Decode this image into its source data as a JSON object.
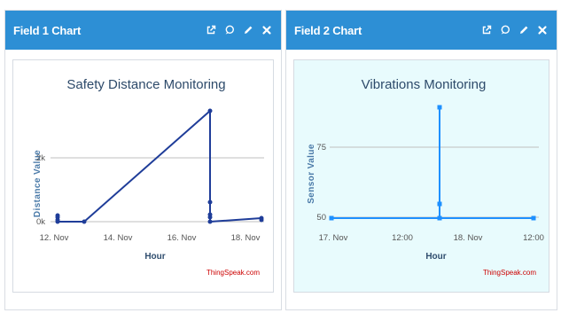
{
  "panels": [
    {
      "title": "Field 1 Chart",
      "icons": [
        "external-link-icon",
        "comment-icon",
        "pencil-icon",
        "close-icon"
      ],
      "chart_data": {
        "type": "line",
        "title": "Safety Distance Monitoring",
        "xlabel": "Hour",
        "ylabel": "Distance Value",
        "x_ticks": [
          "12. Nov",
          "14. Nov",
          "16. Nov",
          "18. Nov"
        ],
        "y_ticks": [
          "0k",
          "2k"
        ],
        "credit": "ThingSpeak.com",
        "color": "#1f3d99",
        "series": [
          {
            "x": [
              "12. Nov 00:00",
              "12. Nov 00:00",
              "12. Nov 00:00",
              "12. Nov 00:00",
              "13. Nov 00:00",
              "17. Nov 02:00",
              "17. Nov 02:00",
              "17. Nov 02:00",
              "17. Nov 02:00",
              "17. Nov 02:00",
              "18. Nov 12:00",
              "18. Nov 12:00"
            ],
            "y": [
              190,
              120,
              50,
              0,
              0,
              3400,
              600,
              200,
              120,
              0,
              110,
              60
            ]
          }
        ],
        "ylim": [
          -100,
          3600
        ],
        "xlim_days": [
          11.9,
          18.8
        ],
        "grid": true
      }
    },
    {
      "title": "Field 2 Chart",
      "icons": [
        "external-link-icon",
        "comment-icon",
        "pencil-icon",
        "close-icon"
      ],
      "chart_data": {
        "type": "line",
        "title": "Vibrations Monitoring",
        "xlabel": "Hour",
        "ylabel": "Sensor Value",
        "x_ticks": [
          "17. Nov",
          "12:00",
          "18. Nov",
          "12:00"
        ],
        "y_ticks": [
          "50",
          "75"
        ],
        "credit": "ThingSpeak.com",
        "color": "#1e90ff",
        "series": [
          {
            "x": [
              "17. Nov 00:00",
              "17. Nov 18:00",
              "17. Nov 18:00",
              "17. Nov 18:00",
              "17. Nov 18:00",
              "19. Nov 00:00"
            ],
            "y": [
              50,
              50,
              55,
              90,
              50,
              50
            ]
          }
        ],
        "ylim": [
          47,
          97
        ],
        "grid": true
      }
    }
  ]
}
